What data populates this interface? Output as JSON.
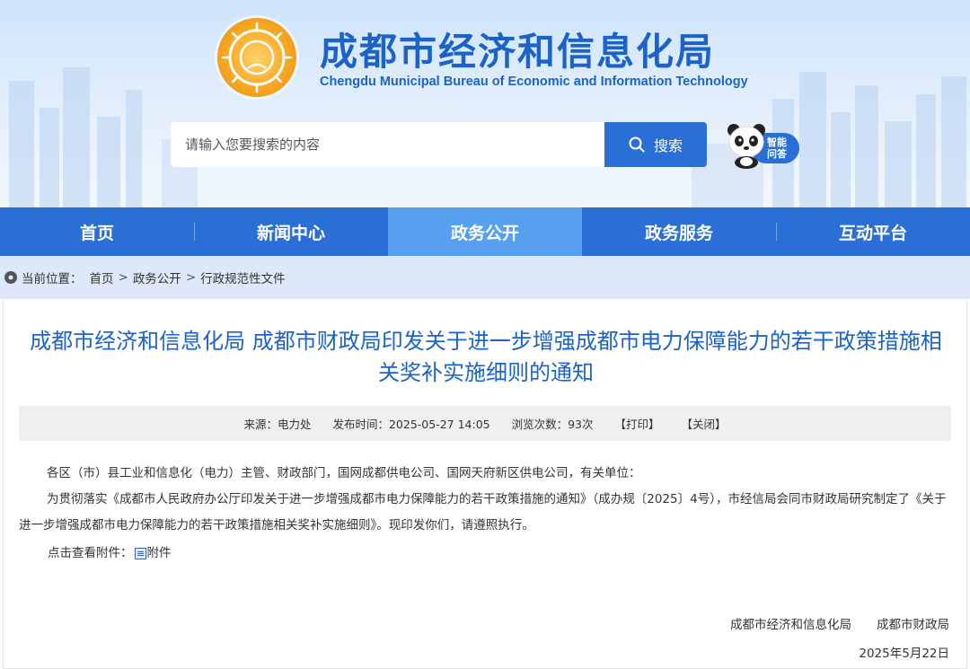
{
  "header": {
    "title": "成都市经济和信息化局",
    "subtitle": "Chengdu Municipal Bureau of Economic and Information Technology",
    "search": {
      "placeholder": "请输入您要搜索的内容",
      "button_label": "搜索"
    },
    "assistant_label_line1": "智能",
    "assistant_label_line2": "问答"
  },
  "nav": {
    "items": [
      {
        "label": "首页"
      },
      {
        "label": "新闻中心"
      },
      {
        "label": "政务公开"
      },
      {
        "label": "政务服务"
      },
      {
        "label": "互动平台"
      }
    ],
    "active_index": 2
  },
  "breadcrumb": {
    "prefix": "当前位置：",
    "items": [
      "首页",
      "政务公开",
      "行政规范性文件"
    ],
    "separator": ">"
  },
  "article": {
    "title": "成都市经济和信息化局 成都市财政局印发关于进一步增强成都市电力保障能力的若干政策措施相关奖补实施细则的通知",
    "meta": {
      "source": "来源：电力处",
      "publish_time": "发布时间：2025-05-27 14:05",
      "views": "浏览次数：93次",
      "print": "【打印】",
      "close": "【关闭】"
    },
    "salutation": "各区（市）县工业和信息化（电力）主管、财政部门，国网成都供电公司、国网天府新区供电公司，有关单位：",
    "paragraph": "为贯彻落实《成都市人民政府办公厅印发关于进一步增强成都市电力保障能力的若干政策措施的通知》（成办规〔2025〕4号），市经信局会同市财政局研究制定了《关于进一步增强成都市电力保障能力的若干政策措施相关奖补实施细则》。现印发你们，请遵照执行。",
    "attachment_prefix": "点击查看附件：",
    "attachment_label": "附件",
    "signer_1": "成都市经济和信息化局",
    "signer_2": "成都市财政局",
    "date": "2025年5月22日"
  },
  "colors": {
    "brand_blue": "#2a6fd6",
    "title_blue": "#1b63c9",
    "nav_active": "#57a0ef"
  }
}
